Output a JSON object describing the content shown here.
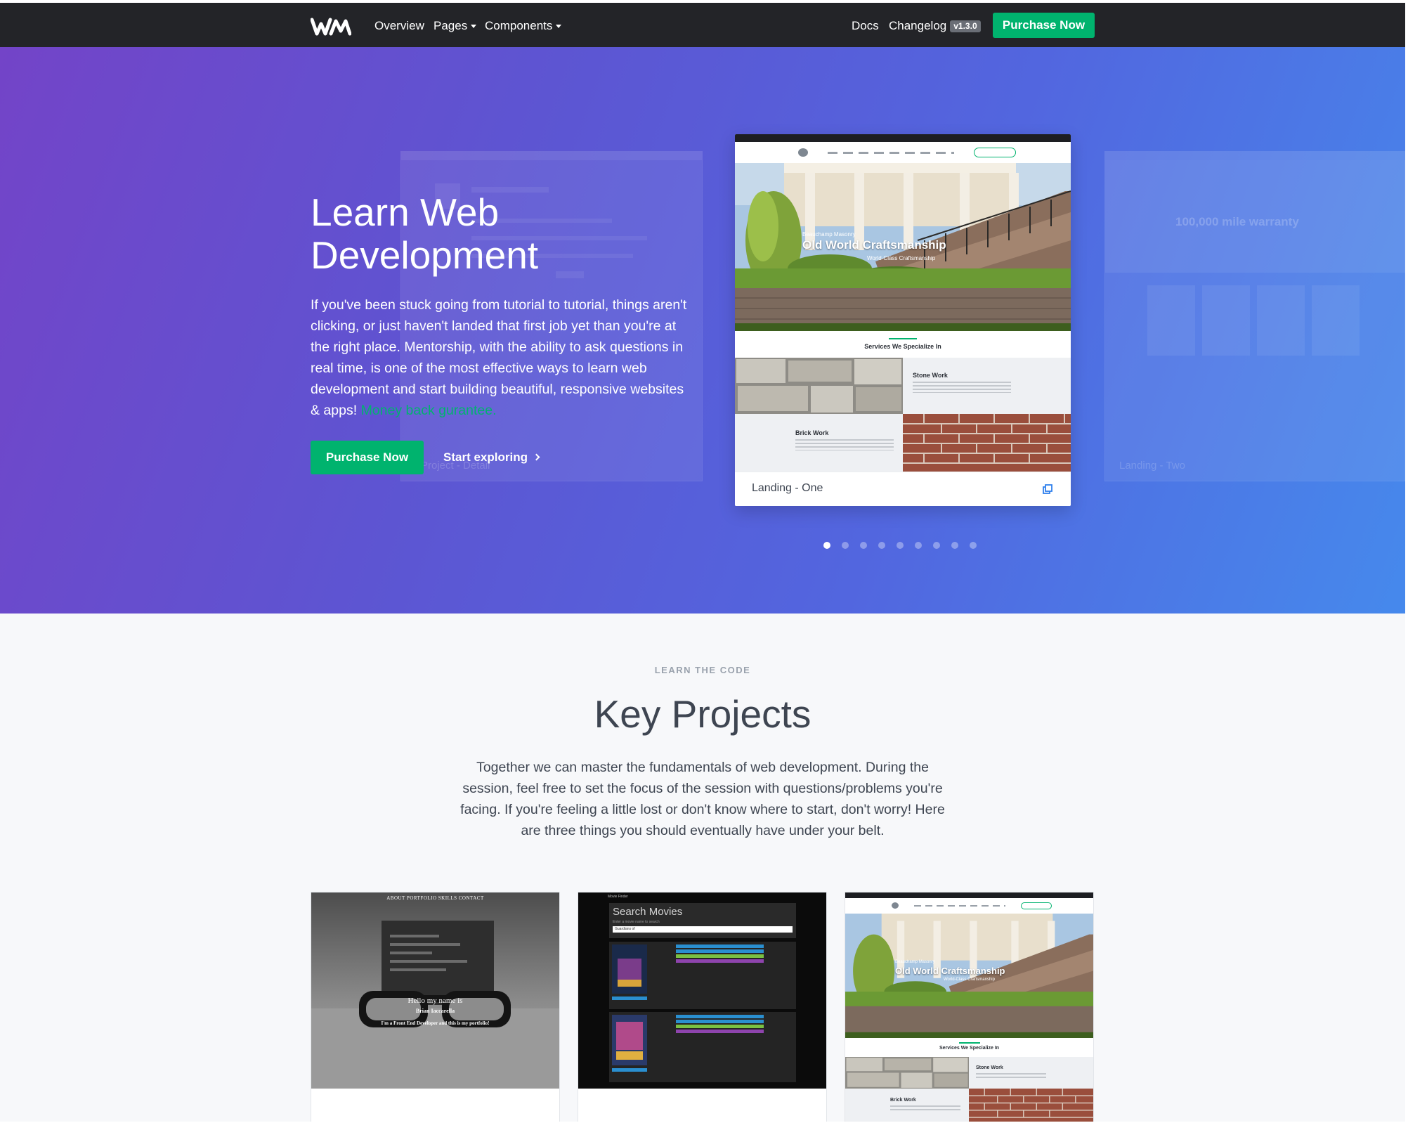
{
  "navbar": {
    "logo_alt": "WM",
    "links": [
      "Overview",
      "Pages",
      "Components"
    ],
    "docs": "Docs",
    "changelog": "Changelog",
    "version": "v1.3.0",
    "purchase": "Purchase Now"
  },
  "hero": {
    "title": "Learn Web Development",
    "description": "If you've been stuck going from tutorial to tutorial, things aren't clicking, or just haven't landed that first job yet than you're at the right place. Mentorship, with the ability to ask questions in real time, is one of the most effective ways to learn web development and start building beautiful, responsive websites & apps!",
    "money_back": "Money back gurantee.",
    "purchase": "Purchase Now",
    "start_exploring": "Start exploring"
  },
  "carousel": {
    "active_slide": {
      "label": "Landing - One",
      "banner_subtitle": "Beauchamp Masonry",
      "banner_title": "Old World Craftsmanship",
      "banner_tagline": "World-Class Craftsmanship",
      "section_heading": "Services We Specialize In",
      "service_1": "Stone Work",
      "service_2": "Brick Work"
    },
    "ghost_right_headline": "100,000 mile warranty",
    "ghost_right_label": "Landing - Two",
    "ghost_left_label": "Project - Detail",
    "dot_count": 9,
    "active_index": 0
  },
  "key_projects": {
    "eyebrow": "LEARN THE CODE",
    "title": "Key Projects",
    "description": "Together we can master the fundamentals of web development. During the session, feel free to set the focus of the session with questions/problems you're facing. If you're feeling a little lost or don't know where to start, don't worry! Here are three things you should eventually have under your belt.",
    "cards": [
      {
        "nav": "ABOUT  PORTFOLIO  SKILLS  CONTACT",
        "hello": "Hello my name is",
        "name": "Brian Iaccarella",
        "tagline": "I'm a Front End Developer and this is my portfolio!"
      },
      {
        "topbar": "Movie Finder",
        "heading": "Search Movies",
        "hint": "Enter a movie name to search",
        "query": "Guardians of"
      },
      {
        "banner_subtitle": "Beauchamp Masonry",
        "banner_title": "Old World Craftsmanship",
        "banner_tagline": "World-Class Craftsmanship",
        "section_heading": "Services We Specialize In",
        "service_1": "Stone Work",
        "service_2": "Brick Work"
      }
    ]
  },
  "colors": {
    "navbar": "#232428",
    "accent_green": "#00b36e",
    "hero_gradient_start": "#7344c8",
    "hero_gradient_end": "#4689ec",
    "page_bg": "#f7f8fa",
    "text": "#3e4551"
  }
}
